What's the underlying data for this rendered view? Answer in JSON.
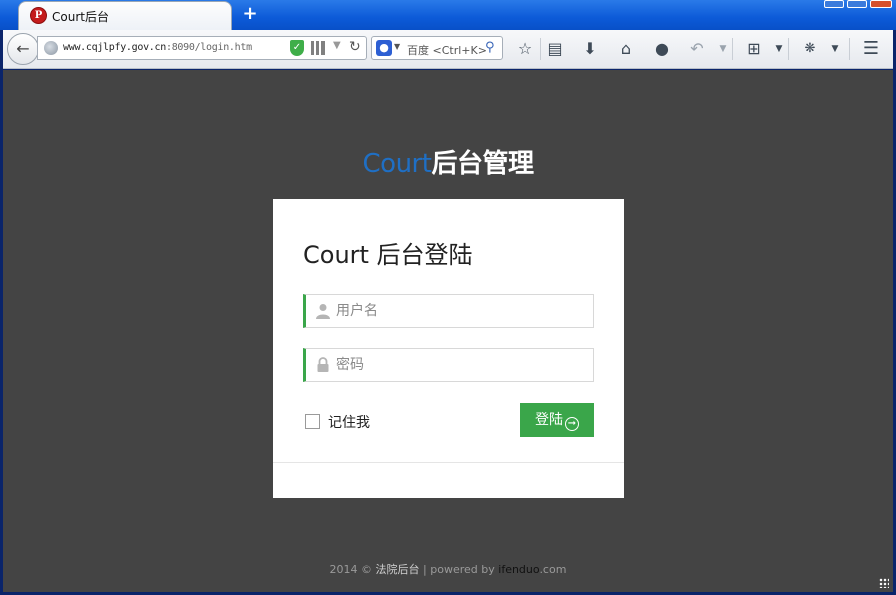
{
  "browser": {
    "tab_title": "Court后台",
    "tab_favicon_letter": "P",
    "new_tab_label": "+",
    "url_host": "www.cqjlpfy.gov.cn",
    "url_rest": ":8090/login.htm",
    "search_engine": "百度",
    "search_placeholder": "<Ctrl+K>",
    "icons": {
      "back": "back-arrow-icon",
      "reload": "reload-icon",
      "bookmark": "star-icon",
      "reader": "clipboard-icon",
      "download": "download-icon",
      "home": "home-icon",
      "chat": "speech-bubble-icon",
      "undo": "undo-icon",
      "screenshot": "crop-icon",
      "bug": "bug-icon",
      "menu": "hamburger-menu-icon"
    }
  },
  "page": {
    "background": "#444444",
    "brand": {
      "court": "Court",
      "rest": "后台管理",
      "court_color": "#1f6fc4"
    },
    "login": {
      "title": "Court 后台登陆",
      "username_placeholder": "用户名",
      "password_placeholder": "密码",
      "remember_label": "记住我",
      "submit_label": "登陆",
      "accent_color": "#3aa64a"
    },
    "footer": {
      "year": "2014",
      "copyright_symbol": "©",
      "site_name": "法院后台",
      "separator": "|",
      "powered_by": "powered by",
      "brand_part": "ifenduo",
      "brand_suffix": ".com"
    }
  }
}
